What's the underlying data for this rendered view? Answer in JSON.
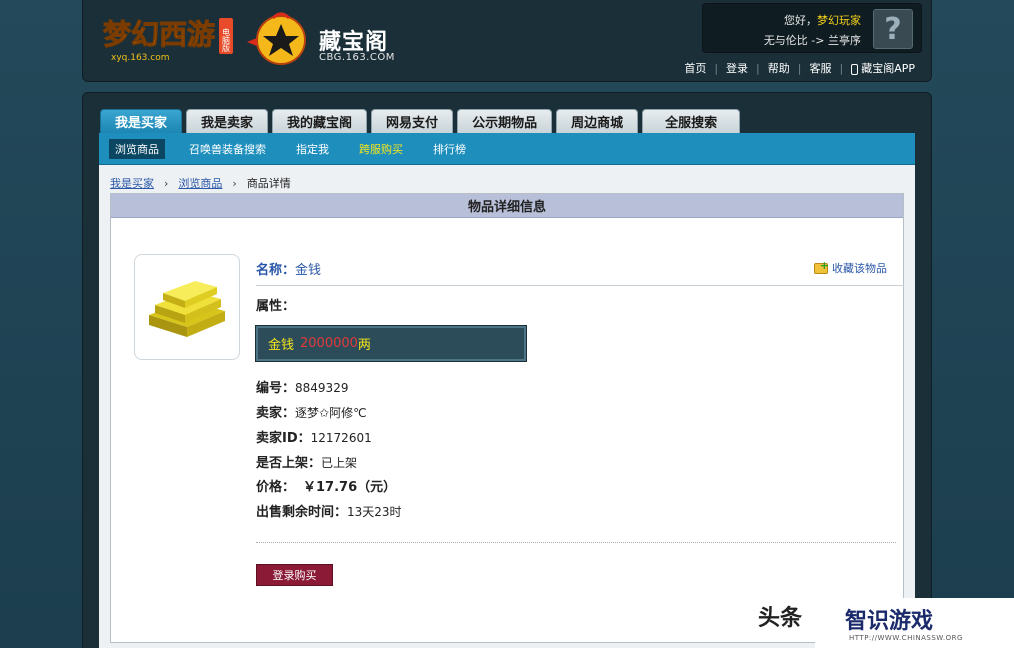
{
  "header": {
    "game_logo_text": "梦幻西游",
    "game_logo_url": "xyq.163.com",
    "game_logo_badge": "电脑版",
    "cbg_title": "藏宝阁",
    "cbg_url": "CBG.163.COM",
    "greeting": "您好，",
    "username": "梦幻玩家",
    "server": "无与伦比 -> 兰亭序",
    "avatar_glyph": "?",
    "links": [
      "首页",
      "登录",
      "帮助",
      "客服"
    ],
    "app_link": "藏宝阁APP"
  },
  "tabs": [
    {
      "label": "我是买家",
      "active": true
    },
    {
      "label": "我是卖家"
    },
    {
      "label": "我的藏宝阁"
    },
    {
      "label": "网易支付"
    },
    {
      "label": "公示期物品"
    },
    {
      "label": "周边商城"
    },
    {
      "label": "全服搜索"
    }
  ],
  "subnav": [
    "浏览商品",
    "召唤兽装备搜索",
    "指定我",
    "跨服购买",
    "排行榜"
  ],
  "breadcrumb": {
    "items": [
      "我是买家",
      "浏览商品"
    ],
    "current": "商品详情"
  },
  "panel": {
    "title": "物品详细信息",
    "name_label": "名称：",
    "name_value": "金钱",
    "favorite": "收藏该物品",
    "attr_label": "属性：",
    "attr_key": "金钱",
    "attr_value": "2000000",
    "attr_unit": "两",
    "id_label": "编号：",
    "id_value": "8849329",
    "seller_label": "卖家：",
    "seller_value": "逐梦✩阿修℃",
    "seller_id_label": "卖家ID：",
    "seller_id_value": "12172601",
    "listed_label": "是否上架：",
    "listed_value": "已上架",
    "price_label": "价格：",
    "price_value": "￥17.76（元）",
    "time_label": "出售剩余时间：",
    "time_value": "13天23时",
    "buy_button": "登录购买"
  },
  "watermark": {
    "left": "头条",
    "title": "智识游戏",
    "sub": "HTTP://WWW.CHINASSW.ORG"
  }
}
